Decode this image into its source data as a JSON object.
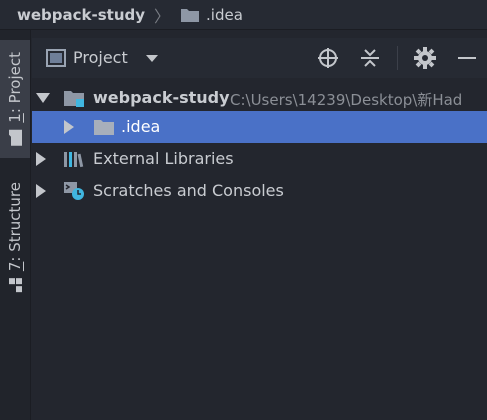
{
  "breadcrumb": {
    "project": "webpack-study",
    "separator": "〉",
    "folder": ".idea"
  },
  "stripe": {
    "project_tab": {
      "number": "1",
      "label": ": Project",
      "icon": "folder-icon"
    },
    "structure_tab": {
      "number": "7",
      "label": ": Structure",
      "icon": "structure-icon"
    }
  },
  "panel": {
    "view_label": "Project",
    "view_icon": "project-view-icon",
    "actions": [
      "locate-icon",
      "collapse-all-icon",
      "gear-icon",
      "minimize-icon"
    ]
  },
  "tree": {
    "rows": [
      {
        "label": "webpack-study",
        "path": "C:\\Users\\14239\\Desktop\\新Had",
        "expanded": true,
        "icon": "module-folder-icon",
        "bold": true
      },
      {
        "label": ".idea",
        "expanded": false,
        "selected": true,
        "icon": "folder-icon"
      },
      {
        "label": "External Libraries",
        "expanded": false,
        "icon": "libraries-icon"
      },
      {
        "label": "Scratches and Consoles",
        "expanded": false,
        "icon": "scratches-icon"
      }
    ]
  },
  "colors": {
    "background": "#23262e",
    "selection": "#4a71c7",
    "text": "#c9ccd1",
    "muted_text": "#8b8f96",
    "accent_cyan": "#40b6e0"
  }
}
